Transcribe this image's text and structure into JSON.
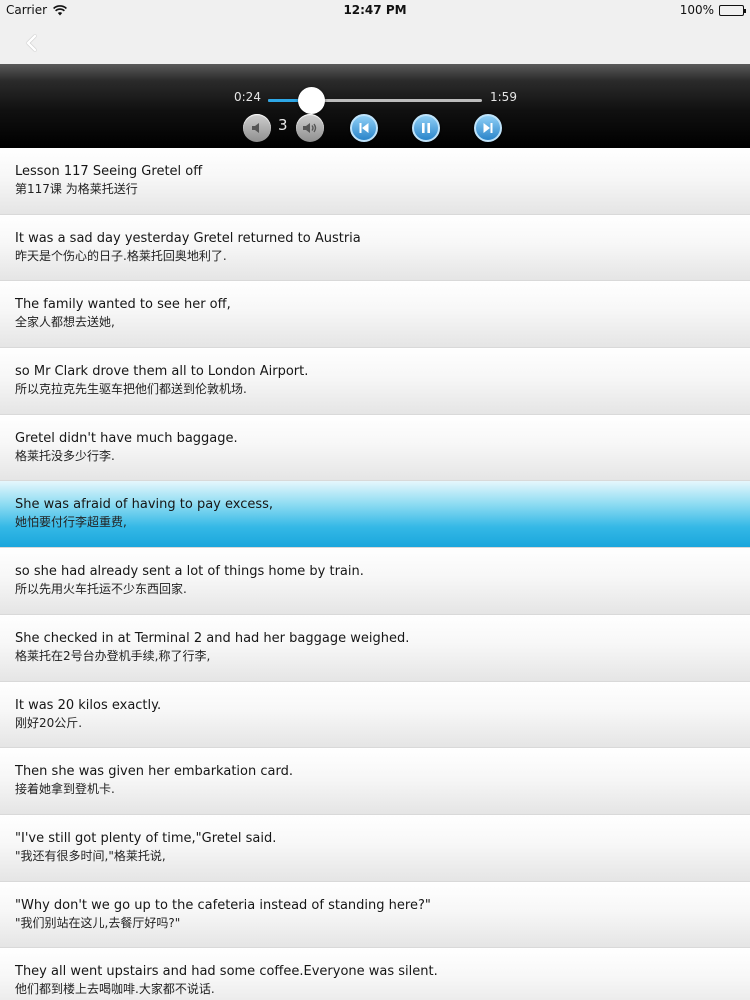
{
  "status_bar": {
    "carrier": "Carrier",
    "time": "12:47 PM",
    "battery": "100%"
  },
  "nav": {
    "back_icon": "chevron-left-icon"
  },
  "player": {
    "elapsed": "0:24",
    "total": "1:59",
    "progress": 0.2,
    "volume_level": "3",
    "accent_color": "#2ea7e6",
    "icons": {
      "volume_down": "speaker-low-icon",
      "volume_up": "speaker-high-icon",
      "previous": "skip-previous-icon",
      "pause": "pause-icon",
      "next": "skip-next-icon"
    }
  },
  "sentences": [
    {
      "en": "Lesson 117  Seeing Gretel off",
      "zh": "第117课 为格莱托送行"
    },
    {
      "en": "It was a sad day yesterday Gretel returned to Austria",
      "zh": "昨天是个伤心的日子.格莱托回奥地利了."
    },
    {
      "en": "The family wanted to see her off,",
      "zh": "全家人都想去送她,"
    },
    {
      "en": "so Mr Clark drove them all to London Airport.",
      "zh": "所以克拉克先生驱车把他们都送到伦敦机场."
    },
    {
      "en": "Gretel didn't have much baggage.",
      "zh": "格莱托没多少行李."
    },
    {
      "en": "She was afraid of having to pay excess,",
      "zh": "她怕要付行李超重费,",
      "active": true
    },
    {
      "en": "so she had already sent a lot of things home by train.",
      "zh": "所以先用火车托运不少东西回家."
    },
    {
      "en": "She checked in at Terminal 2 and had her baggage weighed.",
      "zh": "格莱托在2号台办登机手续,称了行李,"
    },
    {
      "en": "It was 20 kilos exactly.",
      "zh": "刚好20公斤."
    },
    {
      "en": "Then she was given her embarkation card.",
      "zh": "接着她拿到登机卡."
    },
    {
      "en": "\"I've still got plenty of time,\"Gretel said.",
      "zh": "\"我还有很多时间,\"格莱托说,"
    },
    {
      "en": "\"Why don't we go up to the cafeteria instead of standing here?\"",
      "zh": "\"我们别站在这儿,去餐厅好吗?\""
    },
    {
      "en": "They all went upstairs and had some coffee.Everyone was silent.",
      "zh": "他们都到楼上去喝咖啡.大家都不说话."
    }
  ]
}
